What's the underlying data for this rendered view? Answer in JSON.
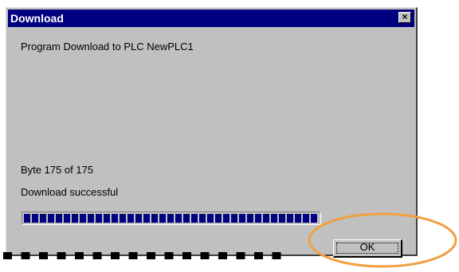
{
  "dialog": {
    "title": "Download",
    "close_label": "×",
    "message": "Program Download to PLC NewPLC1",
    "byte_status": "Byte 175 of 175",
    "result": "Download successful",
    "progress": 1.0,
    "ok_label": "OK"
  },
  "colors": {
    "titlebar": "#000080",
    "face": "#c0c0c0",
    "progress_fill": "#000080",
    "highlight_ring": "#f0a040",
    "dash_marks": "#000000"
  },
  "icons": {
    "close": "close-icon"
  }
}
